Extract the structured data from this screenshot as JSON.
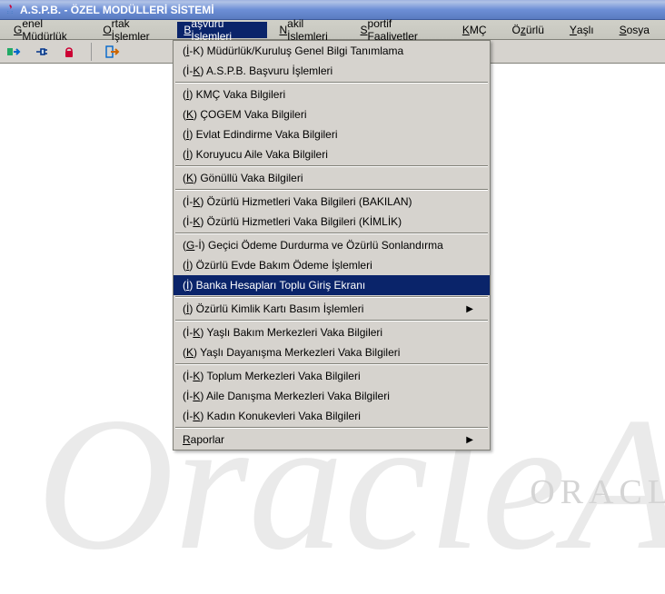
{
  "title": "A.S.P.B. - ÖZEL MODÜLLERİ SİSTEMİ",
  "menubar": {
    "items": [
      {
        "pre": "",
        "u": "G",
        "post": "enel Müdürlük"
      },
      {
        "pre": "",
        "u": "O",
        "post": "rtak İşlemler"
      },
      {
        "pre": "",
        "u": "B",
        "post": "aşvuru İşlemleri"
      },
      {
        "pre": "",
        "u": "N",
        "post": "akil İşlemleri"
      },
      {
        "pre": "",
        "u": "S",
        "post": "portif Faaliyetler"
      }
    ],
    "right": [
      {
        "pre": "",
        "u": "K",
        "post": "MÇ"
      },
      {
        "pre": "Ö",
        "u": "z",
        "post": "ürlü"
      },
      {
        "pre": "",
        "u": "Y",
        "post": "aşlı"
      },
      {
        "pre": "",
        "u": "S",
        "post": "osya"
      }
    ]
  },
  "dropdown": {
    "groups": [
      [
        {
          "pre": "(",
          "u": "İ",
          "post": "-K) Müdürlük/Kuruluş Genel Bilgi Tanımlama",
          "sub": false
        },
        {
          "pre": "(İ-",
          "u": "K",
          "post": ")    A.S.P.B.   Başvuru İşlemleri",
          "sub": false
        }
      ],
      [
        {
          "pre": "(",
          "u": "İ",
          "post": ") KMÇ Vaka Bilgileri",
          "sub": false
        },
        {
          "pre": "(",
          "u": "K",
          "post": ") ÇOGEM Vaka Bilgileri",
          "sub": false
        },
        {
          "pre": "(",
          "u": "İ",
          "post": ") Evlat Edindirme Vaka Bilgileri",
          "sub": false
        },
        {
          "pre": "(",
          "u": "İ",
          "post": ") Koruyucu Aile Vaka Bilgileri",
          "sub": false
        }
      ],
      [
        {
          "pre": "(",
          "u": "K",
          "post": ") Gönüllü Vaka Bilgileri",
          "sub": false
        }
      ],
      [
        {
          "pre": "(İ-",
          "u": "K",
          "post": ") Özürlü Hizmetleri Vaka Bilgileri (BAKILAN)",
          "sub": false
        },
        {
          "pre": "(İ-",
          "u": "K",
          "post": ") Özürlü Hizmetleri Vaka Bilgileri (KİMLİK)",
          "sub": false
        }
      ],
      [
        {
          "pre": "(",
          "u": "G",
          "post": "-İ) Geçici Ödeme Durdurma ve Özürlü Sonlandırma",
          "sub": false
        },
        {
          "pre": "(",
          "u": "İ",
          "post": ") Özürlü Evde Bakım Ödeme İşlemleri",
          "sub": false
        },
        {
          "pre": "(",
          "u": "İ",
          "post": ") Banka Hesapları Toplu Giriş Ekranı",
          "sub": false,
          "hl": true
        }
      ],
      [
        {
          "pre": "(",
          "u": "İ",
          "post": ") Özürlü Kimlik Kartı Basım İşlemleri",
          "sub": true
        }
      ],
      [
        {
          "pre": "(İ-",
          "u": "K",
          "post": ") Yaşlı Bakım Merkezleri Vaka Bilgileri",
          "sub": false
        },
        {
          "pre": "(",
          "u": "K",
          "post": ") Yaşlı Dayanışma Merkezleri Vaka Bilgileri",
          "sub": false
        }
      ],
      [
        {
          "pre": "(İ-",
          "u": "K",
          "post": ") Toplum Merkezleri Vaka Bilgileri",
          "sub": false
        },
        {
          "pre": "(İ-",
          "u": "K",
          "post": ") Aile Danışma Merkezleri Vaka Bilgileri",
          "sub": false
        },
        {
          "pre": "(İ-",
          "u": "K",
          "post": ") Kadın Konukevleri Vaka Bilgileri",
          "sub": false
        }
      ],
      [
        {
          "pre": "",
          "u": "R",
          "post": "aporlar",
          "sub": true
        }
      ]
    ]
  },
  "watermark": "ORACL",
  "watermark2": "OracleAS"
}
